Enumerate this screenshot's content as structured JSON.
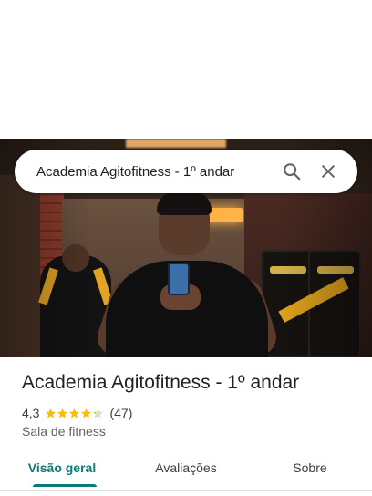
{
  "search": {
    "query": "Academia Agitofitness - 1º andar"
  },
  "hero": {
    "icon": "gym-photo"
  },
  "place": {
    "title": "Academia Agitofitness - 1º andar",
    "rating": "4,3",
    "rating_value": 4.3,
    "reviews_count": "(47)",
    "category": "Sala de fitness"
  },
  "tabs": [
    {
      "label": "Visão geral",
      "active": true
    },
    {
      "label": "Avaliações",
      "active": false
    },
    {
      "label": "Sobre",
      "active": false
    }
  ],
  "colors": {
    "accent": "#0b7a78",
    "star": "#fbbc04"
  }
}
